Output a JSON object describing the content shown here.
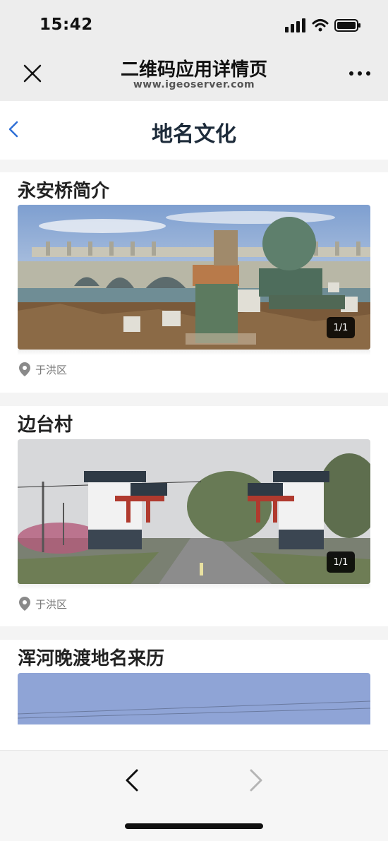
{
  "status_bar": {
    "time": "15:42"
  },
  "wechat_header": {
    "title": "二维码应用详情页",
    "subtitle": "www.igeoserver.com"
  },
  "nav": {
    "title": "地名文化"
  },
  "cards": [
    {
      "title": "永安桥简介",
      "badge": "1/1",
      "location": "于洪区"
    },
    {
      "title": "边台村",
      "badge": "1/1",
      "location": "于洪区"
    },
    {
      "title": "浑河晚渡地名来历"
    }
  ],
  "colors": {
    "accent": "#2f6fd6",
    "header_bg": "#ededed",
    "divider": "#f4f4f4"
  },
  "icons": [
    "close-icon",
    "more-icon",
    "back-chevron-icon",
    "location-pin-icon",
    "prev-icon",
    "next-icon"
  ]
}
